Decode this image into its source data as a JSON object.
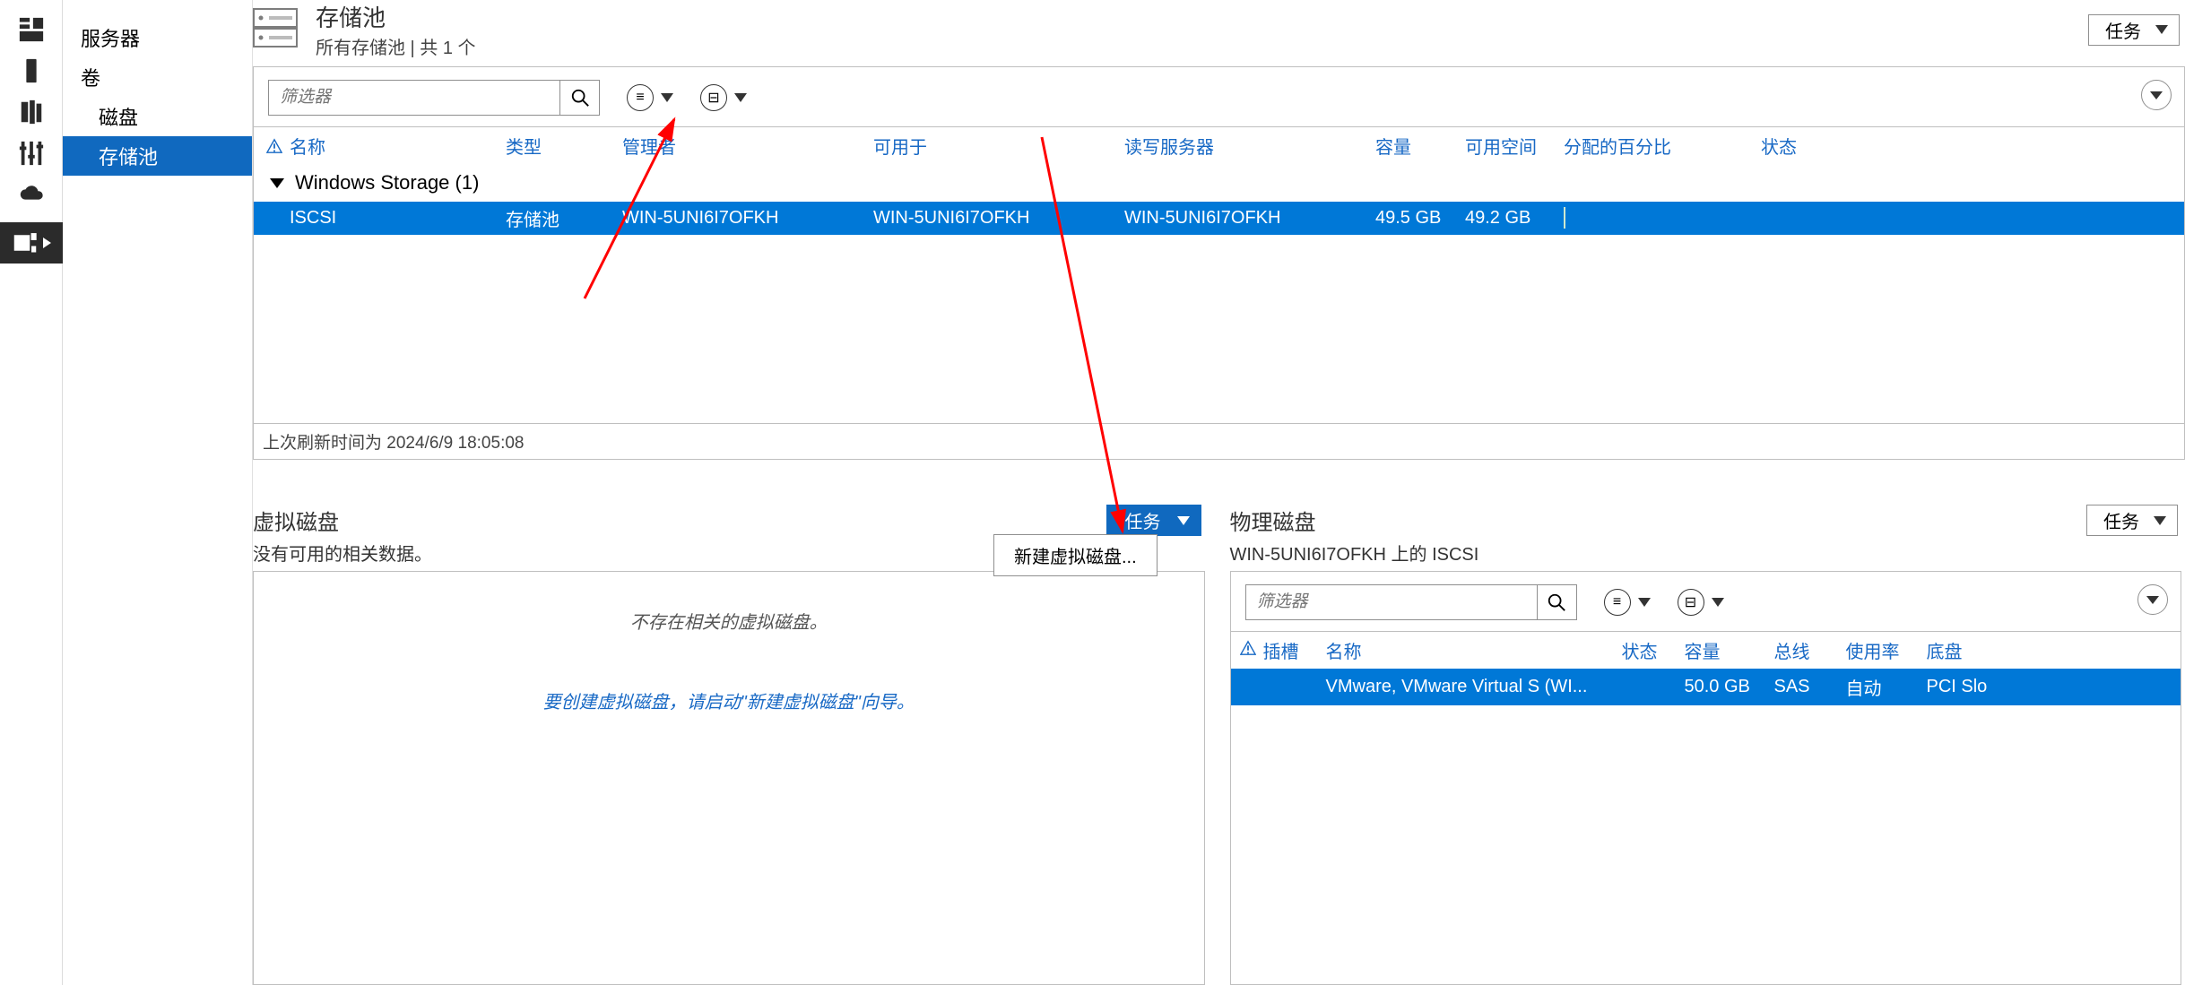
{
  "nav": {
    "servers": "服务器",
    "volumes": "卷",
    "disks": "磁盘",
    "pools": "存储池"
  },
  "pool_header": {
    "title": "存储池",
    "subtitle": "所有存储池 | 共 1 个",
    "tasks": "任务"
  },
  "toolbar": {
    "filter_placeholder": "筛选器"
  },
  "columns": {
    "name": "名称",
    "type": "类型",
    "manager": "管理者",
    "available_for": "可用于",
    "rw_server": "读写服务器",
    "capacity": "容量",
    "free": "可用空间",
    "alloc_pct": "分配的百分比",
    "status": "状态"
  },
  "group": {
    "label": "Windows Storage (1)"
  },
  "row": {
    "name": "ISCSI",
    "type": "存储池",
    "manager": "WIN-5UNI6I7OFKH",
    "available_for": "WIN-5UNI6I7OFKH",
    "rw_server": "WIN-5UNI6I7OFKH",
    "capacity": "49.5 GB",
    "free": "49.2 GB"
  },
  "footer": {
    "refreshed": "上次刷新时间为 2024/6/9 18:05:08"
  },
  "vdisk": {
    "title": "虚拟磁盘",
    "subtitle": "没有可用的相关数据。",
    "tasks": "任务",
    "empty_msg": "不存在相关的虚拟磁盘。",
    "hint": "要创建虚拟磁盘，请启动\"新建虚拟磁盘\"向导。"
  },
  "menu": {
    "new_vdisk": "新建虚拟磁盘..."
  },
  "pdisk": {
    "title": "物理磁盘",
    "subtitle": "WIN-5UNI6I7OFKH 上的 ISCSI",
    "tasks": "任务",
    "filter_placeholder": "筛选器",
    "cols": {
      "slot": "插槽",
      "name": "名称",
      "status": "状态",
      "capacity": "容量",
      "bus": "总线",
      "usage": "使用率",
      "chassis": "底盘"
    },
    "row": {
      "name": "VMware, VMware Virtual S (WI...",
      "capacity": "50.0 GB",
      "bus": "SAS",
      "usage": "自动",
      "chassis": "PCI Slo"
    }
  }
}
